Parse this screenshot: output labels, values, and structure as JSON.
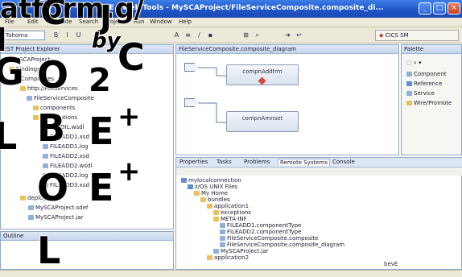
{
  "window": {
    "title": "J2EE - Web Tools - MySCAProject/FileServiceComposite.composite_di...",
    "buttons": [
      "_",
      "□",
      "×"
    ]
  },
  "menu": [
    "File",
    "Edit",
    "Navigate",
    "Search",
    "Project",
    "Run",
    "Window",
    "Help"
  ],
  "toolbar": {
    "combo": "Tahoma",
    "perspective": "CICS SM"
  },
  "explorer": {
    "header": "EST Project Explorer",
    "items": [
      "MySCAProject",
      "bindings",
      "Composites",
      "http://FileServices",
      "FileServiceComposite",
      "components",
      "contributions",
      "BPFOIL.wsdl",
      "FILEADD1.xsd",
      "FILEADD1.log",
      "FILEADD2.xsd",
      "FILEADD2.wsdl",
      "FILEADD2.log",
      "FILEADD3.xsd",
      "deployment",
      "MySCAProject.sdef",
      "MySCAProject.jar"
    ]
  },
  "outline": {
    "header": "Outline"
  },
  "editor": {
    "tab": "FileServiceComposite.composite_diagram",
    "components": [
      {
        "label": "compnAddfrm"
      },
      {
        "label": "compnAmnset"
      }
    ]
  },
  "palette": {
    "header": "Palette",
    "items": [
      "Component",
      "Reference",
      "Service",
      "Wire/Promote"
    ]
  },
  "bottom": {
    "tabs": [
      "Properties",
      "Tasks",
      "Problems",
      "Remote Systems",
      "Console"
    ],
    "active_tab": "Remote Systems",
    "tree": [
      "mylocalconnection",
      "z/OS UNIX Files",
      "My Home",
      "bundles",
      "application1",
      "exceptions",
      "META-INF",
      "FILEADD1.componentType",
      "FILEADD2.componentType",
      "FileServiceComposite.composite",
      "FileServiceComposite.composite_diagram",
      "MySCAProject.jar",
      "application2"
    ],
    "footer": "bevE"
  },
  "overlay": {
    "top_text": "atform.g/",
    "by_text": "by",
    "glyphs": [
      "C",
      "J",
      "C",
      "O",
      "2",
      "B",
      "E",
      "+",
      "O",
      "E",
      "+",
      "L",
      "I",
      "G",
      "L"
    ]
  },
  "colors": {
    "titlebar": "#1f56c8",
    "chrome": "#ece9d8",
    "pane_border": "#8fa7c9",
    "accent_red": "#d24b3f"
  }
}
